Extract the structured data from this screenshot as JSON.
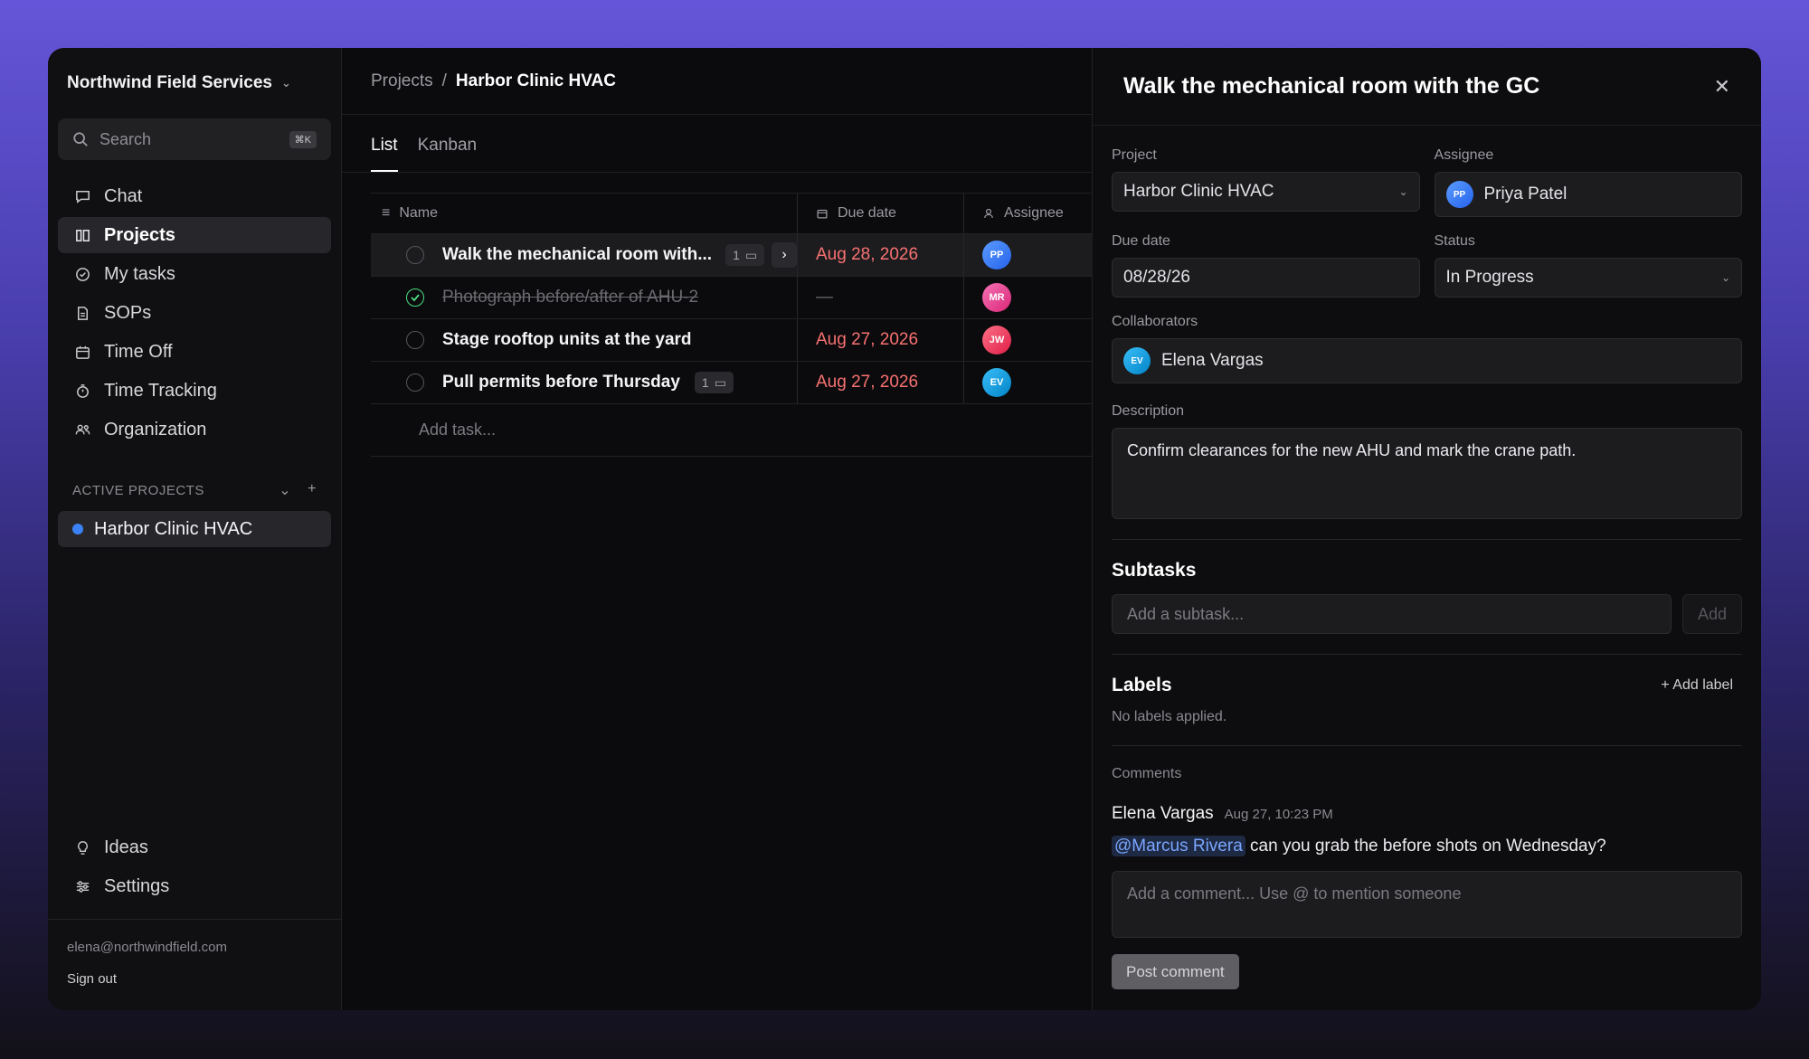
{
  "sidebar": {
    "org_name": "Northwind Field Services",
    "search_placeholder": "Search",
    "search_shortcut": "⌘K",
    "nav": [
      {
        "label": "Chat",
        "icon": "chat-icon"
      },
      {
        "label": "Projects",
        "icon": "columns-icon",
        "active": true
      },
      {
        "label": "My tasks",
        "icon": "check-circle-icon"
      },
      {
        "label": "SOPs",
        "icon": "document-icon"
      },
      {
        "label": "Time Off",
        "icon": "calendar-icon"
      },
      {
        "label": "Time Tracking",
        "icon": "stopwatch-icon"
      },
      {
        "label": "Organization",
        "icon": "people-icon"
      }
    ],
    "active_projects_header": "ACTIVE PROJECTS",
    "projects": [
      {
        "label": "Harbor Clinic HVAC",
        "color": "#3b82f6"
      }
    ],
    "bottom_nav": [
      {
        "label": "Ideas",
        "icon": "lightbulb-icon"
      },
      {
        "label": "Settings",
        "icon": "sliders-icon"
      }
    ],
    "user_email": "elena@northwindfield.com",
    "sign_out": "Sign out"
  },
  "main": {
    "breadcrumb": {
      "parent": "Projects",
      "separator": "/",
      "current": "Harbor Clinic HVAC"
    },
    "tabs": [
      {
        "label": "List",
        "active": true
      },
      {
        "label": "Kanban"
      }
    ],
    "columns": {
      "name": "Name",
      "due": "Due date",
      "assignee": "Assignee"
    },
    "tasks": [
      {
        "name": "Walk the mechanical room with...",
        "comments": "1",
        "due": "Aug 28, 2026",
        "assignee": "PP",
        "avatar_color": "#3b82f6",
        "selected": true,
        "done": false
      },
      {
        "name": "Photograph before/after of AHU-2",
        "comments": "",
        "due": "—",
        "assignee": "MR",
        "avatar_color": "#ec4899",
        "done": true
      },
      {
        "name": "Stage rooftop units at the yard",
        "comments": "",
        "due": "Aug 27, 2026",
        "assignee": "JW",
        "avatar_color": "#f43f5e",
        "done": false
      },
      {
        "name": "Pull permits before Thursday",
        "comments": "1",
        "due": "Aug 27, 2026",
        "assignee": "EV",
        "avatar_color": "#0ea5e9",
        "done": false
      }
    ],
    "add_task_placeholder": "Add task..."
  },
  "detail": {
    "title": "Walk the mechanical room with the GC",
    "labels": {
      "project": "Project",
      "assignee": "Assignee",
      "due": "Due date",
      "status": "Status",
      "collaborators": "Collaborators",
      "description": "Description",
      "subtasks": "Subtasks",
      "labels": "Labels",
      "comments": "Comments"
    },
    "project": "Harbor Clinic HVAC",
    "assignee": {
      "initials": "PP",
      "name": "Priya Patel",
      "color": "#3b82f6"
    },
    "due_date": "08/28/26",
    "status": "In Progress",
    "collaborator": {
      "initials": "EV",
      "name": "Elena Vargas",
      "color": "#0ea5e9"
    },
    "description": "Confirm clearances for the new AHU and mark the crane path.",
    "subtask_placeholder": "Add a subtask...",
    "subtask_add": "Add",
    "add_label": "+ Add label",
    "no_labels": "No labels applied.",
    "comment": {
      "author": "Elena Vargas",
      "time": "Aug 27, 10:23 PM",
      "mention": "@Marcus Rivera",
      "text": " can you grab the before shots on Wednesday?"
    },
    "comment_placeholder": "Add a comment... Use @ to mention someone",
    "post_comment": "Post comment"
  }
}
